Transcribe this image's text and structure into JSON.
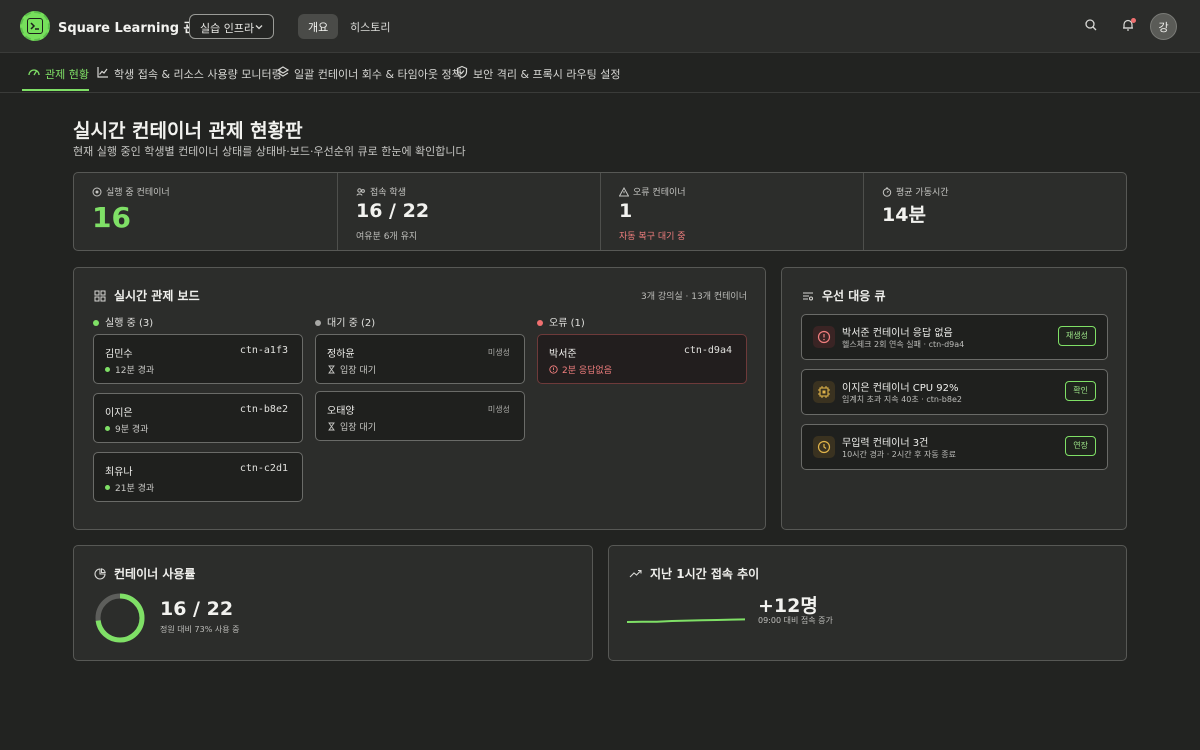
{
  "header": {
    "brand": "Square Learning 관제",
    "env_select": "실습 인프라",
    "tabs": [
      {
        "label": "개요",
        "active": true
      },
      {
        "label": "히스토리",
        "active": false
      }
    ],
    "avatar_initial": "강"
  },
  "subnav": [
    {
      "label": "관제 현황",
      "icon": "gauge-icon",
      "active": true
    },
    {
      "label": "학생 접속 & 리소스 사용량 모니터링",
      "icon": "line-chart-icon",
      "active": false
    },
    {
      "label": "일괄 컨테이너 회수 & 타임아웃 정책",
      "icon": "layers-icon",
      "active": false
    },
    {
      "label": "보안 격리 & 프록시 라우팅 설정",
      "icon": "shield-icon",
      "active": false
    }
  ],
  "page": {
    "title": "실시간 컨테이너 관제 현황판",
    "subtitle": "현재 실행 중인 학생별 컨테이너 상태를 상태바·보드·우선순위 큐로 한눈에 확인합니다"
  },
  "stats": [
    {
      "label": "실행 중 컨테이너",
      "value": "16",
      "note": ""
    },
    {
      "label": "접속 학생",
      "value": "16 / 22",
      "note": "여유분 6개 유지"
    },
    {
      "label": "오류 컨테이너",
      "value": "1",
      "note": "자동 복구 대기 중"
    },
    {
      "label": "평균 가동시간",
      "value": "14분",
      "note": ""
    }
  ],
  "board": {
    "title": "실시간 관제 보드",
    "meta": "3개 강의실 · 13개 컨테이너",
    "columns": [
      {
        "label": "실행 중 (3)",
        "color": "#7fe066",
        "cards": [
          {
            "name": "김민수",
            "id": "ctn-a1f3",
            "status": "12분 경과"
          },
          {
            "name": "이지은",
            "id": "ctn-b8e2",
            "status": "9분 경과"
          },
          {
            "name": "최유나",
            "id": "ctn-c2d1",
            "status": "21분 경과"
          }
        ]
      },
      {
        "label": "대기 중 (2)",
        "color": "#a8a8a5",
        "cards": [
          {
            "name": "정하윤",
            "id": "미생성",
            "status": "입장 대기"
          },
          {
            "name": "오태양",
            "id": "미생성",
            "status": "입장 대기"
          }
        ]
      },
      {
        "label": "오류 (1)",
        "color": "#f07070",
        "cards": [
          {
            "name": "박서준",
            "id": "ctn-d9a4",
            "status": "2분 응답없음"
          }
        ]
      }
    ]
  },
  "queue": {
    "title": "우선 대응 큐",
    "items": [
      {
        "title": "박서준 컨테이너 응답 없음",
        "sub": "헬스체크 2회 연속 실패 · ctn-d9a4",
        "action": "재생성",
        "icon": "alert-circle-icon"
      },
      {
        "title": "이지은 컨테이너 CPU 92%",
        "sub": "임계치 초과 지속 40초 · ctn-b8e2",
        "action": "확인",
        "icon": "cpu-icon"
      },
      {
        "title": "무입력 컨테이너 3건",
        "sub": "10시간 경과 · 2시간 후 자동 종료",
        "action": "연장",
        "icon": "clock-icon"
      }
    ]
  },
  "usage": {
    "title": "컨테이너 사용률",
    "value": "16 / 22",
    "sub": "정원 대비 73% 사용 중",
    "fraction": 0.73
  },
  "trend": {
    "title": "지난 1시간 접속 추이",
    "value": "+12명",
    "sub": "09:00 대비 접속 증가"
  },
  "colors": {
    "accent": "#7fe066",
    "error": "#f07070",
    "warning": "#e0b44a"
  }
}
